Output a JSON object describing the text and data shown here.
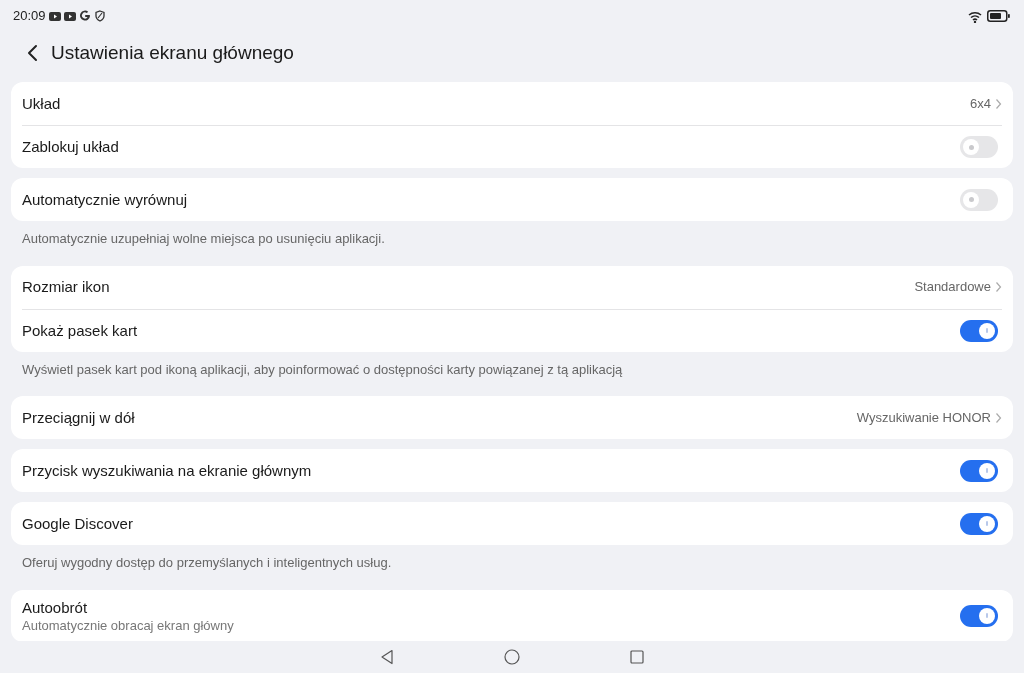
{
  "status_bar": {
    "time": "20:09"
  },
  "header": {
    "title": "Ustawienia ekranu głównego"
  },
  "groups": [
    {
      "rows": [
        {
          "kind": "value",
          "label": "Układ",
          "value": "6x4"
        },
        {
          "kind": "toggle",
          "label": "Zablokuj układ",
          "on": false
        }
      ]
    },
    {
      "rows": [
        {
          "kind": "toggle",
          "label": "Automatycznie wyrównuj",
          "on": false
        }
      ],
      "description": "Automatycznie uzupełniaj wolne miejsca po usunięciu aplikacji."
    },
    {
      "rows": [
        {
          "kind": "value",
          "label": "Rozmiar ikon",
          "value": "Standardowe"
        },
        {
          "kind": "toggle",
          "label": "Pokaż pasek kart",
          "on": true
        }
      ],
      "description": "Wyświetl pasek kart pod ikoną aplikacji, aby poinformować o dostępności karty powiązanej z tą aplikacją"
    },
    {
      "rows": [
        {
          "kind": "value",
          "label": "Przeciągnij w dół",
          "value": "Wyszukiwanie HONOR"
        }
      ]
    },
    {
      "rows": [
        {
          "kind": "toggle",
          "label": "Przycisk wyszukiwania na ekranie głównym",
          "on": true
        }
      ]
    },
    {
      "rows": [
        {
          "kind": "toggle",
          "label": "Google Discover",
          "on": true
        }
      ],
      "description": "Oferuj wygodny dostęp do przemyślanych i inteligentnych usług."
    },
    {
      "rows": [
        {
          "kind": "toggle",
          "label": "Autoobrót",
          "subtitle": "Automatycznie obracaj ekran główny",
          "on": true
        }
      ]
    }
  ]
}
